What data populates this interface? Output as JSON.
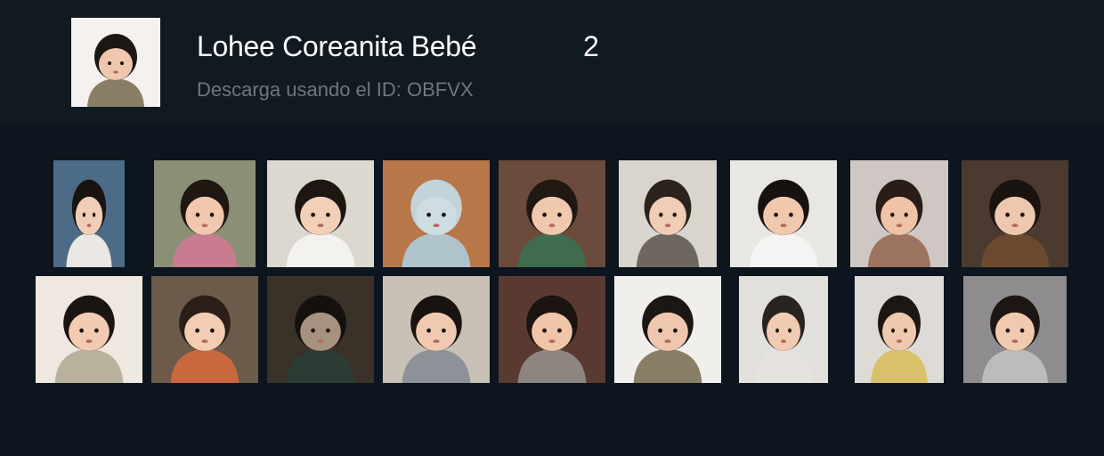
{
  "pack": {
    "title": "Lohee Coreanita Bebé",
    "count": "2",
    "subtitle": "Descarga usando el ID: OBFVX",
    "cover": {
      "bg": "#f4f1ee",
      "hair": "#1c1614",
      "skin": "#efc7ae",
      "clothes": "#8a7d66"
    }
  },
  "stickers": [
    {
      "name": "sticker-baby-car-seat",
      "bg": "#4c6b86",
      "hair": "#1a1410",
      "skin": "#f0cdb6",
      "clothes": "#e9e6e3"
    },
    {
      "name": "sticker-baby-covering-eyes",
      "bg": "#8b8f76",
      "hair": "#1e1712",
      "skin": "#f1c8ad",
      "clothes": "#c97b90"
    },
    {
      "name": "sticker-baby-lying-bed",
      "bg": "#dcd7cf",
      "hair": "#1d1613",
      "skin": "#f2cfb8",
      "clothes": "#f4f2ef"
    },
    {
      "name": "sticker-baby-hooded-blanket",
      "bg": "#b77749",
      "hair": "#c2d3da",
      "skin": "#cfdde2",
      "clothes": "#aec3cc"
    },
    {
      "name": "sticker-baby-green-dress-bench",
      "bg": "#6a4b3c",
      "hair": "#201813",
      "skin": "#efc8ad",
      "clothes": "#3f6b4f"
    },
    {
      "name": "sticker-baby-striped-shirt",
      "bg": "#d9d4cd",
      "hair": "#2b221c",
      "skin": "#efcdb6",
      "clothes": "#6d6760"
    },
    {
      "name": "sticker-baby-bob-haircut",
      "bg": "#e9e7e4",
      "hair": "#161210",
      "skin": "#f0c8ae",
      "clothes": "#f5f4f2"
    },
    {
      "name": "sticker-baby-curly-hair",
      "bg": "#cfc7c3",
      "hair": "#2a1d17",
      "skin": "#eec3a8",
      "clothes": "#9c7360"
    },
    {
      "name": "sticker-baby-phone-basket",
      "bg": "#4b3a30",
      "hair": "#1a1411",
      "skin": "#eec8ae",
      "clothes": "#6b4a2f"
    },
    {
      "name": "sticker-baby-surprised",
      "bg": "#efe8e1",
      "hair": "#1b1512",
      "skin": "#f2cbb2",
      "clothes": "#b8b19c"
    },
    {
      "name": "sticker-baby-salute",
      "bg": "#6c5a4b",
      "hair": "#2b1f18",
      "skin": "#f2cdb4",
      "clothes": "#c9673f"
    },
    {
      "name": "sticker-baby-dark-room",
      "bg": "#3a3128",
      "hair": "#14100d",
      "skin": "#a7917f",
      "clothes": "#2d3b35"
    },
    {
      "name": "sticker-baby-pouting",
      "bg": "#c9c1b6",
      "hair": "#1a1410",
      "skin": "#f0cab0",
      "clothes": "#8d9298"
    },
    {
      "name": "sticker-baby-winking",
      "bg": "#5a3a30",
      "hair": "#1b1411",
      "skin": "#f0c5a8",
      "clothes": "#8c8580"
    },
    {
      "name": "sticker-baby-crying",
      "bg": "#f1efec",
      "hair": "#1c1614",
      "skin": "#efc7ae",
      "clothes": "#8a7d66"
    },
    {
      "name": "sticker-baby-hat-toy",
      "bg": "#e2e0dd",
      "hair": "#2a2420",
      "skin": "#f1ccb3",
      "clothes": "#e6e3df"
    },
    {
      "name": "sticker-baby-dancing",
      "bg": "#dedbd7",
      "hair": "#1d1713",
      "skin": "#efc9ae",
      "clothes": "#d8c16a"
    },
    {
      "name": "sticker-baby-leather-sofa",
      "bg": "#8e8c8e",
      "hair": "#1d1612",
      "skin": "#f0c9ae",
      "clothes": "#bcbcbc"
    }
  ]
}
